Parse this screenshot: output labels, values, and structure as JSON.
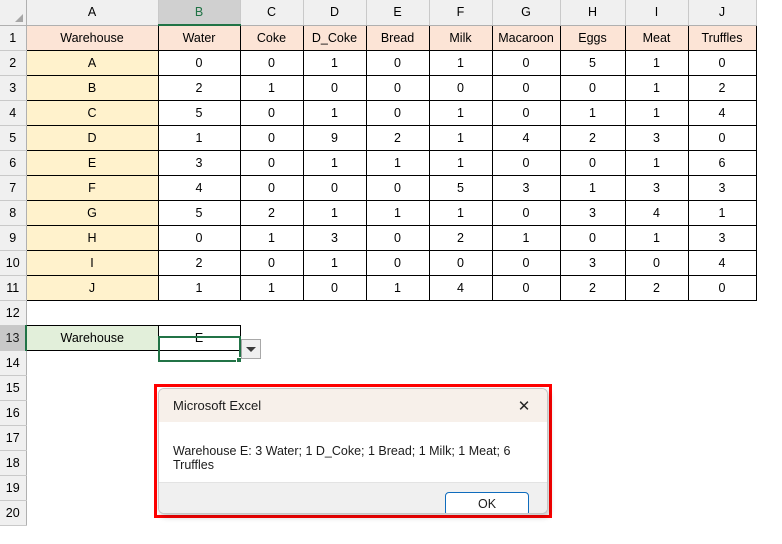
{
  "spreadsheet": {
    "column_headers": [
      "A",
      "B",
      "C",
      "D",
      "E",
      "F",
      "G",
      "H",
      "I",
      "J"
    ],
    "selected_column": "B",
    "selected_row": "13",
    "selected_cell": "B13",
    "row_numbers": [
      "1",
      "2",
      "3",
      "4",
      "5",
      "6",
      "7",
      "8",
      "9",
      "10",
      "11",
      "12",
      "13",
      "14",
      "15",
      "16",
      "17",
      "18",
      "19",
      "20"
    ],
    "table": {
      "headers": [
        "Warehouse",
        "Water",
        "Coke",
        "D_Coke",
        "Bread",
        "Milk",
        "Macaroon",
        "Eggs",
        "Meat",
        "Truffles"
      ],
      "rows": [
        [
          "A",
          "0",
          "0",
          "1",
          "0",
          "1",
          "0",
          "5",
          "1",
          "0"
        ],
        [
          "B",
          "2",
          "1",
          "0",
          "0",
          "0",
          "0",
          "0",
          "1",
          "2"
        ],
        [
          "C",
          "5",
          "0",
          "1",
          "0",
          "1",
          "0",
          "1",
          "1",
          "4"
        ],
        [
          "D",
          "1",
          "0",
          "9",
          "2",
          "1",
          "4",
          "2",
          "3",
          "0"
        ],
        [
          "E",
          "3",
          "0",
          "1",
          "1",
          "1",
          "0",
          "0",
          "1",
          "6"
        ],
        [
          "F",
          "4",
          "0",
          "0",
          "0",
          "5",
          "3",
          "1",
          "3",
          "3"
        ],
        [
          "G",
          "5",
          "2",
          "1",
          "1",
          "1",
          "0",
          "3",
          "4",
          "1"
        ],
        [
          "H",
          "0",
          "1",
          "3",
          "0",
          "2",
          "1",
          "0",
          "1",
          "3"
        ],
        [
          "I",
          "2",
          "0",
          "1",
          "0",
          "0",
          "0",
          "3",
          "0",
          "4"
        ],
        [
          "J",
          "1",
          "1",
          "0",
          "1",
          "4",
          "0",
          "2",
          "2",
          "0"
        ]
      ]
    },
    "lookup": {
      "label": "Warehouse",
      "value": "E",
      "dropdown_icon": "chevron-down-icon"
    },
    "colors": {
      "header_fill": "#FCE4D6",
      "rowlabel_fill": "#FFF2CC",
      "lookup_label_fill": "#E2EFDA",
      "selection_green": "#217346",
      "annotation_red": "#FF0000"
    }
  },
  "dialog": {
    "title": "Microsoft Excel",
    "close_icon": "close-icon",
    "message": "Warehouse E: 3 Water; 1 D_Coke; 1 Bread; 1 Milk; 1 Meat; 6 Truffles",
    "ok_label": "OK"
  }
}
